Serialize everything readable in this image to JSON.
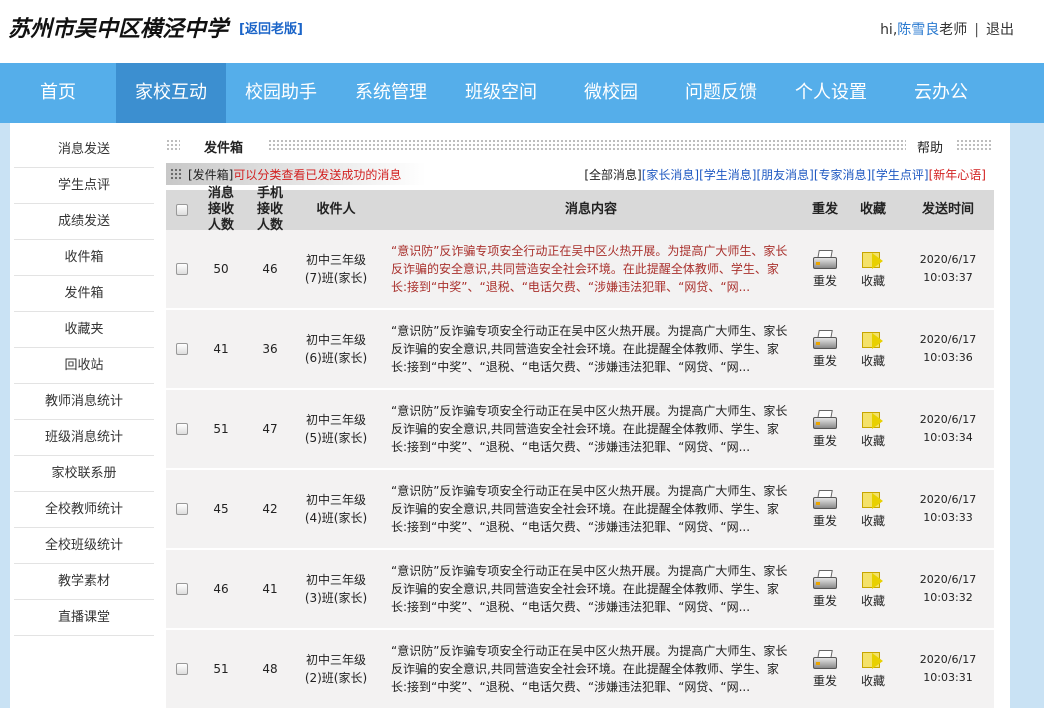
{
  "header": {
    "school_name": "苏州市吴中区横泾中学",
    "old_version_link": "[返回老版]",
    "greeting": "hi,",
    "user_name": "陈雪良",
    "user_role": "老师",
    "separator": "|",
    "logout": "退出"
  },
  "nav": {
    "items": [
      {
        "label": "首页"
      },
      {
        "label": "家校互动"
      },
      {
        "label": "校园助手"
      },
      {
        "label": "系统管理"
      },
      {
        "label": "班级空间"
      },
      {
        "label": "微校园"
      },
      {
        "label": "问题反馈"
      },
      {
        "label": "个人设置"
      },
      {
        "label": "云办公"
      }
    ],
    "active": "家校互动"
  },
  "sidebar": {
    "items": [
      {
        "label": "消息发送"
      },
      {
        "label": "学生点评"
      },
      {
        "label": "成绩发送"
      },
      {
        "label": "收件箱"
      },
      {
        "label": "发件箱"
      },
      {
        "label": "收藏夹"
      },
      {
        "label": "回收站"
      },
      {
        "label": "教师消息统计"
      },
      {
        "label": "班级消息统计"
      },
      {
        "label": "家校联系册"
      },
      {
        "label": "全校教师统计"
      },
      {
        "label": "全校班级统计"
      },
      {
        "label": "教学素材"
      },
      {
        "label": "直播课堂"
      }
    ]
  },
  "main": {
    "tab_title": "发件箱",
    "help": "帮助",
    "filter": {
      "label": "[发件箱]",
      "note": "可以分类查看已发送成功的消息",
      "links": [
        {
          "label": "[全部消息]",
          "color": "#222222"
        },
        {
          "label": "[家长消息]",
          "color": "#1f59c2"
        },
        {
          "label": "[学生消息]",
          "color": "#1f59c2"
        },
        {
          "label": "[朋友消息]",
          "color": "#1f59c2"
        },
        {
          "label": "[专家消息]",
          "color": "#1f59c2"
        },
        {
          "label": "[学生点评]",
          "color": "#1f59c2"
        },
        {
          "label": "[新年心语]",
          "color": "#d21f1f"
        }
      ]
    },
    "table": {
      "headers": {
        "received_a": "消息接收人数",
        "received_b": "手机接收人数",
        "recipient": "收件人",
        "content": "消息内容",
        "resend": "重发",
        "favorite": "收藏",
        "time": "发送时间"
      },
      "rows": [
        {
          "msg_count": "50",
          "phone_count": "46",
          "recipient_line1": "初中三年级",
          "recipient_line2": "(7)班(家长)",
          "content": "“意识防”反诈骗专项安全行动正在吴中区火热开展。为提高广大师生、家长反诈骗的安全意识,共同营造安全社会环境。在此提醒全体教师、学生、家长:接到“中奖”、“退税、“电话欠费、“涉嫌违法犯罪、“网贷、“网...",
          "resend": "重发",
          "favorite": "收藏",
          "date": "2020/6/17",
          "time": "10:03:37",
          "highlight": true
        },
        {
          "msg_count": "41",
          "phone_count": "36",
          "recipient_line1": "初中三年级",
          "recipient_line2": "(6)班(家长)",
          "content": "“意识防”反诈骗专项安全行动正在吴中区火热开展。为提高广大师生、家长反诈骗的安全意识,共同营造安全社会环境。在此提醒全体教师、学生、家长:接到“中奖”、“退税、“电话欠费、“涉嫌违法犯罪、“网贷、“网...",
          "resend": "重发",
          "favorite": "收藏",
          "date": "2020/6/17",
          "time": "10:03:36",
          "highlight": false
        },
        {
          "msg_count": "51",
          "phone_count": "47",
          "recipient_line1": "初中三年级",
          "recipient_line2": "(5)班(家长)",
          "content": "“意识防”反诈骗专项安全行动正在吴中区火热开展。为提高广大师生、家长反诈骗的安全意识,共同营造安全社会环境。在此提醒全体教师、学生、家长:接到“中奖”、“退税、“电话欠费、“涉嫌违法犯罪、“网贷、“网...",
          "resend": "重发",
          "favorite": "收藏",
          "date": "2020/6/17",
          "time": "10:03:34",
          "highlight": false
        },
        {
          "msg_count": "45",
          "phone_count": "42",
          "recipient_line1": "初中三年级",
          "recipient_line2": "(4)班(家长)",
          "content": "“意识防”反诈骗专项安全行动正在吴中区火热开展。为提高广大师生、家长反诈骗的安全意识,共同营造安全社会环境。在此提醒全体教师、学生、家长:接到“中奖”、“退税、“电话欠费、“涉嫌违法犯罪、“网贷、“网...",
          "resend": "重发",
          "favorite": "收藏",
          "date": "2020/6/17",
          "time": "10:03:33",
          "highlight": false
        },
        {
          "msg_count": "46",
          "phone_count": "41",
          "recipient_line1": "初中三年级",
          "recipient_line2": "(3)班(家长)",
          "content": "“意识防”反诈骗专项安全行动正在吴中区火热开展。为提高广大师生、家长反诈骗的安全意识,共同营造安全社会环境。在此提醒全体教师、学生、家长:接到“中奖”、“退税、“电话欠费、“涉嫌违法犯罪、“网贷、“网...",
          "resend": "重发",
          "favorite": "收藏",
          "date": "2020/6/17",
          "time": "10:03:32",
          "highlight": false
        },
        {
          "msg_count": "51",
          "phone_count": "48",
          "recipient_line1": "初中三年级",
          "recipient_line2": "(2)班(家长)",
          "content": "“意识防”反诈骗专项安全行动正在吴中区火热开展。为提高广大师生、家长反诈骗的安全意识,共同营造安全社会环境。在此提醒全体教师、学生、家长:接到“中奖”、“退税、“电话欠费、“涉嫌违法犯罪、“网贷、“网...",
          "resend": "重发",
          "favorite": "收藏",
          "date": "2020/6/17",
          "time": "10:03:31",
          "highlight": false
        }
      ]
    }
  },
  "colors": {
    "nav_bg": "#55aeea",
    "nav_active": "#3c8fd0",
    "page_bg": "#c9e2f4",
    "link_blue": "#1f59c2",
    "alert_red": "#d21f1f"
  },
  "icons": {
    "resend": "printer-icon",
    "favorite": "folder-arrow-icon"
  }
}
